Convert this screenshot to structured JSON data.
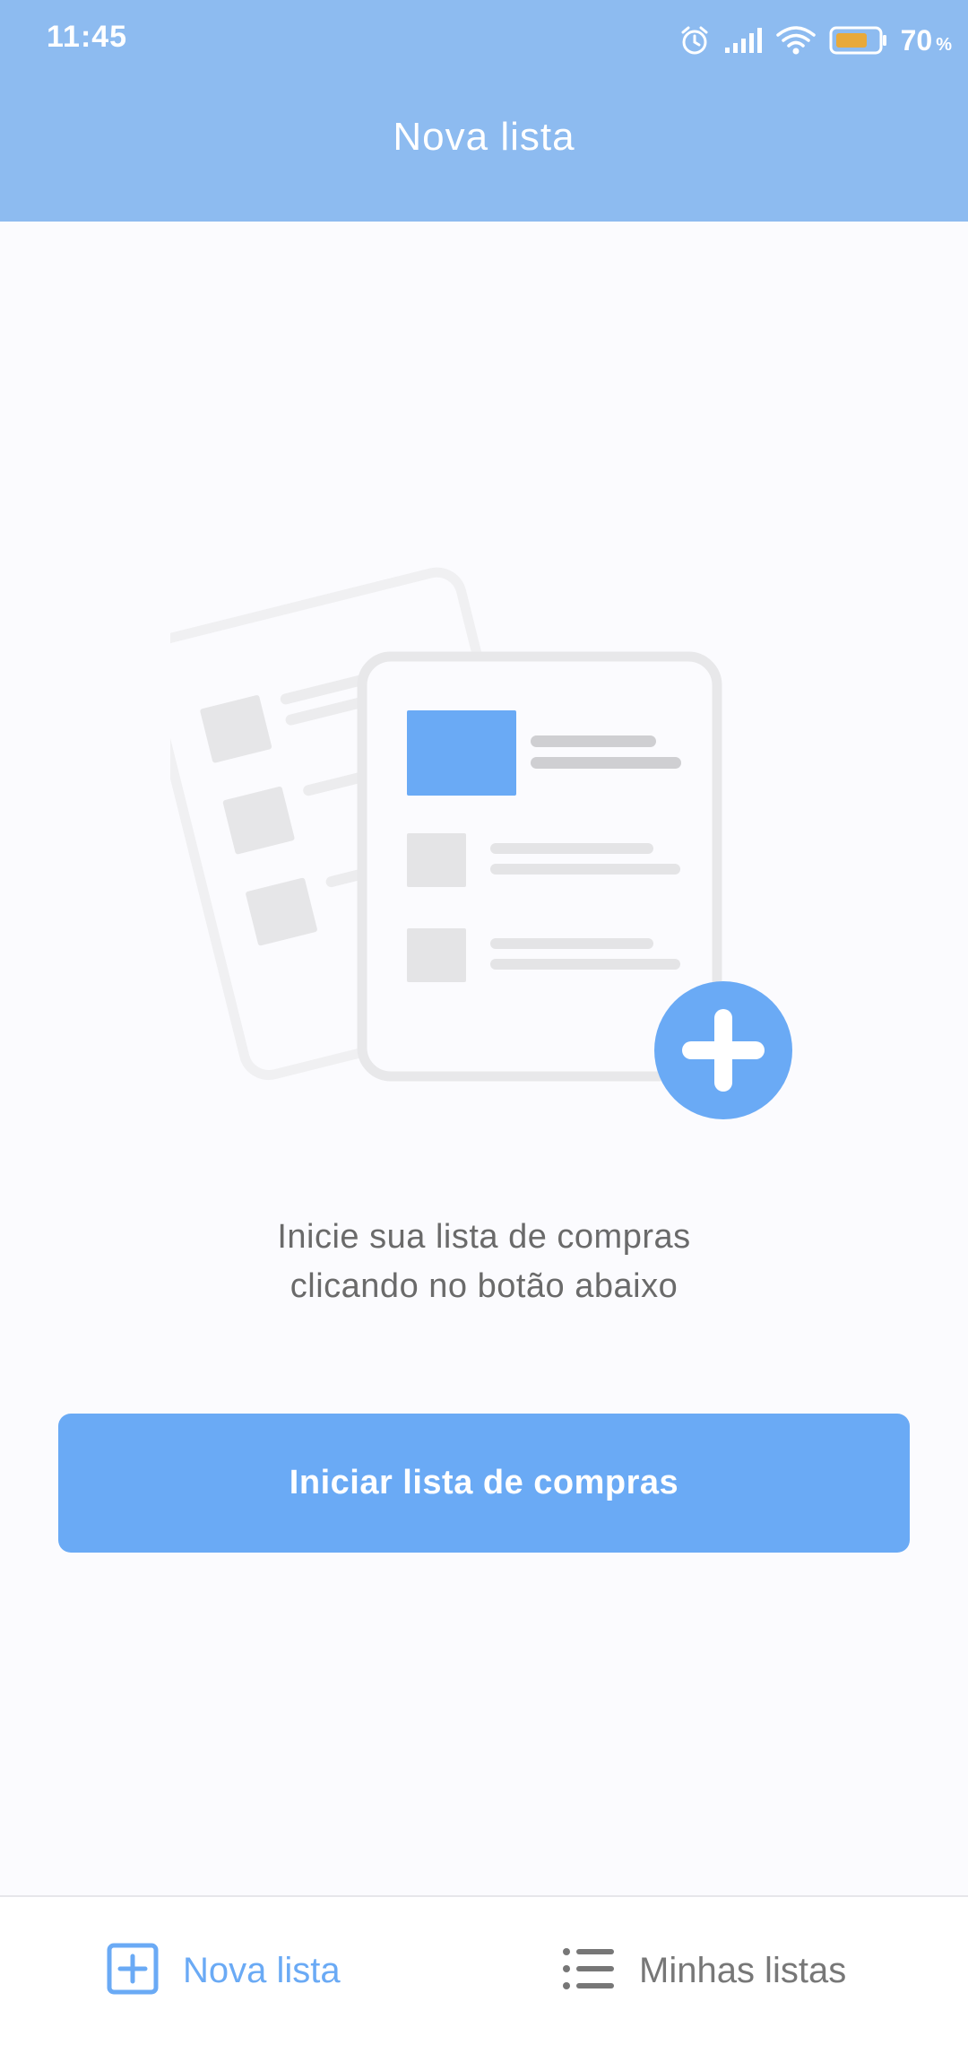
{
  "status_bar": {
    "time": "11:45",
    "battery_level": "70",
    "battery_unit": "%",
    "icons": [
      "alarm-icon",
      "signal-icon",
      "wifi-icon",
      "battery-icon"
    ]
  },
  "app_bar": {
    "title": "Nova lista"
  },
  "empty_state": {
    "illustration": "shopping-list-add-illustration",
    "message_line1": "Inicie sua lista de compras",
    "message_line2": "clicando no botão abaixo"
  },
  "primary_action": {
    "label": "Iniciar lista de compras"
  },
  "bottom_nav": {
    "items": [
      {
        "label": "Nova lista",
        "icon": "plus-square-icon",
        "active": true
      },
      {
        "label": "Minhas listas",
        "icon": "list-icon",
        "active": false
      }
    ]
  },
  "colors": {
    "header": "#8DBBF0",
    "accent": "#6AAAF5",
    "background": "#FBFBFE",
    "text_secondary": "#6A6A6A",
    "nav_inactive": "#777777"
  }
}
